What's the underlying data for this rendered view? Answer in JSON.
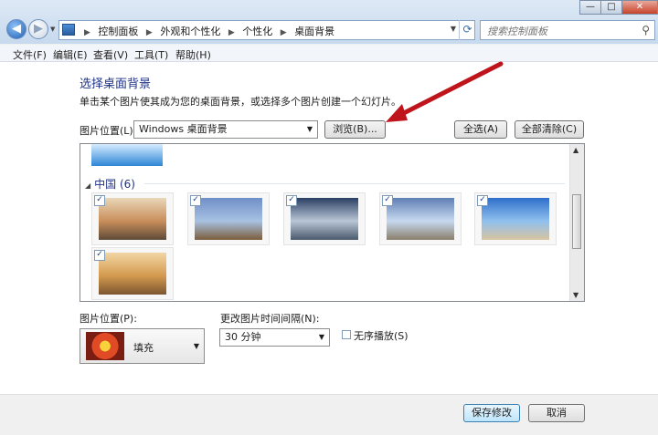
{
  "window": {
    "minimize_glyph": "—",
    "maximize_glyph": "□",
    "close_glyph": "✕"
  },
  "address_bar": {
    "breadcrumbs": [
      "控制面板",
      "外观和个性化",
      "个性化",
      "桌面背景"
    ],
    "separator": "▶",
    "search_placeholder": "搜索控制面板"
  },
  "menu": {
    "items": [
      "文件(F)",
      "编辑(E)",
      "查看(V)",
      "工具(T)",
      "帮助(H)"
    ]
  },
  "main": {
    "title": "选择桌面背景",
    "description": "单击某个图片使其成为您的桌面背景，或选择多个图片创建一个幻灯片。",
    "picture_location_label": "图片位置(L):",
    "picture_location_value": "Windows 桌面背景",
    "browse_button": "浏览(B)...",
    "select_all_button": "全选(A)",
    "clear_all_button": "全部清除(C)"
  },
  "gallery": {
    "group_label": "中国 (6)",
    "thumbnails": [
      {
        "name": "karst-river",
        "checked": true,
        "colors": [
          "#e9d7b8",
          "#c98e5b",
          "#5e4a38"
        ]
      },
      {
        "name": "great-wall",
        "checked": true,
        "colors": [
          "#6f8fc7",
          "#a8c2e3",
          "#7b5d3a"
        ]
      },
      {
        "name": "rocky-peaks",
        "checked": true,
        "colors": [
          "#2a3f63",
          "#b9c6d6",
          "#4a5a6d"
        ]
      },
      {
        "name": "terraced-fields",
        "checked": true,
        "colors": [
          "#5f7fb5",
          "#c7d9f0",
          "#8a7f6b"
        ]
      },
      {
        "name": "sand-dunes",
        "checked": true,
        "colors": [
          "#2f6fcb",
          "#8fc0ee",
          "#d8c4a0"
        ]
      },
      {
        "name": "stone-bridge",
        "checked": true,
        "colors": [
          "#f2d6a4",
          "#d49a4f",
          "#7d5630"
        ]
      }
    ]
  },
  "options": {
    "position_label": "图片位置(P):",
    "position_value": "填充",
    "interval_label": "更改图片时间间隔(N):",
    "interval_value": "30 分钟",
    "shuffle_label": "无序播放(S)",
    "shuffle_checked": false
  },
  "footer": {
    "save_button": "保存修改",
    "cancel_button": "取消"
  },
  "colors": {
    "title_text": "#1e3287",
    "annotation_arrow": "#c0141c"
  }
}
